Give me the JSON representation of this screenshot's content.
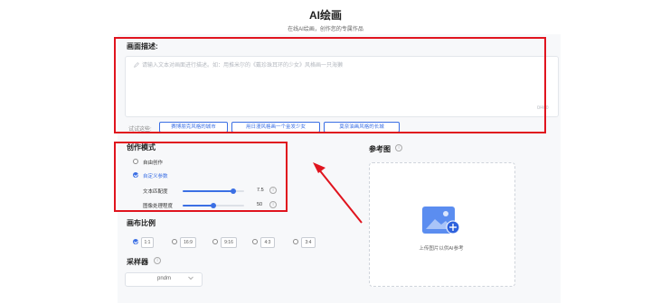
{
  "header": {
    "title": "AI绘画",
    "subtitle": "在线AI绘画，创作您的专属作品"
  },
  "description": {
    "label": "画面描述:",
    "placeholder": "请输入文本对画面进行描述。如：用推米尔的《戴珍珠耳环的少女》风格画一只海獭",
    "counter": "0/400",
    "try_label": "试试这些:",
    "suggestions": [
      "赛博朋克风格的城市",
      "用日漫风格画一个金发少女",
      "莫奈油画风格的长城"
    ]
  },
  "mode": {
    "label": "创作模式",
    "options": [
      {
        "label": "自由创作",
        "selected": false
      },
      {
        "label": "自定义参数",
        "selected": true
      }
    ],
    "sliders": [
      {
        "label": "文本匹配度",
        "value": "7.5",
        "fraction": 0.83
      },
      {
        "label": "图像处理程度",
        "value": "50",
        "fraction": 0.5
      }
    ]
  },
  "ratio": {
    "label": "画布比例",
    "options": [
      "1:1",
      "16:9",
      "9:16",
      "4:3",
      "3:4"
    ],
    "selected_index": 0
  },
  "sampler": {
    "label": "采样器",
    "value": "pndm"
  },
  "reference": {
    "label": "参考图",
    "upload_text": "上传图片以供AI参考"
  },
  "colors": {
    "accent": "#3b6fe4",
    "highlight": "#e0141e"
  }
}
